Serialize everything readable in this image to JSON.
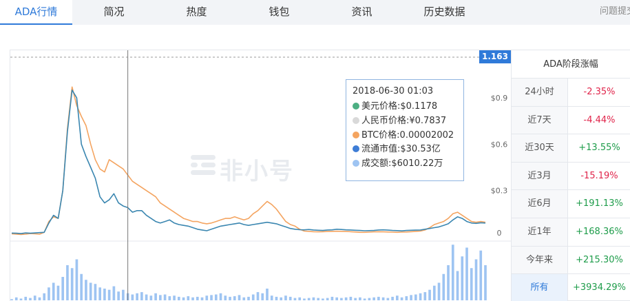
{
  "tabs": [
    {
      "label": "ADA行情",
      "active": true
    },
    {
      "label": "简况"
    },
    {
      "label": "热度"
    },
    {
      "label": "钱包"
    },
    {
      "label": "资讯"
    },
    {
      "label": "历史数据"
    }
  ],
  "feedback_label": "问题提交",
  "chart": {
    "price_badge": "1.163",
    "watermark": "非小号",
    "tooltip": {
      "time": "2018-06-30 01:03",
      "rows": [
        {
          "text": "美元价格:$0.1178",
          "color": "#4caf83"
        },
        {
          "text": "人民币价格:¥0.7837",
          "color": "#d9d9d9"
        },
        {
          "text": "BTC价格:0.00002002",
          "color": "#f4a460"
        },
        {
          "text": "流通市值:$30.53亿",
          "color": "#3e7dd6"
        },
        {
          "text": "成交额:$6010.22万",
          "color": "#9ec4f2"
        }
      ]
    }
  },
  "chart_data": {
    "type": "line",
    "ylim": [
      0,
      1.163
    ],
    "yticks": [
      "$0.9",
      "$0.6",
      "$0.3",
      "0"
    ],
    "ytick_values": [
      0.9,
      0.6,
      0.3,
      0
    ],
    "reference_line": 1.163,
    "crosshair_index": 25,
    "x_count": 103,
    "series": [
      {
        "name": "美元价格",
        "color": "#3a86b0",
        "values": [
          0.025,
          0.024,
          0.022,
          0.026,
          0.024,
          0.026,
          0.028,
          0.03,
          0.09,
          0.14,
          0.12,
          0.3,
          0.68,
          0.95,
          0.9,
          0.6,
          0.52,
          0.45,
          0.38,
          0.26,
          0.22,
          0.24,
          0.28,
          0.22,
          0.2,
          0.19,
          0.16,
          0.17,
          0.17,
          0.14,
          0.12,
          0.1,
          0.09,
          0.1,
          0.11,
          0.09,
          0.08,
          0.075,
          0.07,
          0.06,
          0.05,
          0.045,
          0.04,
          0.05,
          0.06,
          0.07,
          0.075,
          0.08,
          0.085,
          0.09,
          0.08,
          0.075,
          0.08,
          0.085,
          0.09,
          0.095,
          0.09,
          0.085,
          0.075,
          0.065,
          0.055,
          0.05,
          0.047,
          0.046,
          0.048,
          0.045,
          0.043,
          0.042,
          0.045,
          0.046,
          0.05,
          0.048,
          0.046,
          0.045,
          0.043,
          0.042,
          0.04,
          0.041,
          0.042,
          0.045,
          0.046,
          0.044,
          0.042,
          0.041,
          0.039,
          0.042,
          0.043,
          0.044,
          0.045,
          0.05,
          0.055,
          0.06,
          0.065,
          0.075,
          0.085,
          0.11,
          0.13,
          0.12,
          0.1,
          0.09,
          0.088,
          0.092,
          0.09
        ]
      },
      {
        "name": "BTC价格",
        "color": "#f4a460",
        "values": [
          0.02,
          0.018,
          0.016,
          0.018,
          0.022,
          0.02,
          0.018,
          0.03,
          0.1,
          0.13,
          0.12,
          0.3,
          0.7,
          0.97,
          0.85,
          0.78,
          0.72,
          0.6,
          0.5,
          0.44,
          0.42,
          0.5,
          0.48,
          0.46,
          0.44,
          0.4,
          0.36,
          0.34,
          0.32,
          0.3,
          0.28,
          0.26,
          0.22,
          0.2,
          0.18,
          0.16,
          0.14,
          0.12,
          0.11,
          0.1,
          0.1,
          0.09,
          0.085,
          0.09,
          0.1,
          0.11,
          0.12,
          0.12,
          0.13,
          0.12,
          0.11,
          0.12,
          0.15,
          0.17,
          0.2,
          0.23,
          0.21,
          0.18,
          0.14,
          0.1,
          0.08,
          0.07,
          0.05,
          0.038,
          0.036,
          0.034,
          0.033,
          0.034,
          0.035,
          0.036,
          0.037,
          0.036,
          0.035,
          0.034,
          0.032,
          0.03,
          0.03,
          0.031,
          0.033,
          0.034,
          0.033,
          0.032,
          0.031,
          0.03,
          0.031,
          0.032,
          0.034,
          0.036,
          0.038,
          0.045,
          0.06,
          0.08,
          0.09,
          0.1,
          0.12,
          0.15,
          0.16,
          0.14,
          0.12,
          0.1,
          0.095,
          0.1,
          0.095
        ]
      },
      {
        "name": "成交额",
        "color": "#9ec4f2",
        "values": [
          0.02,
          0.05,
          0.03,
          0.06,
          0.04,
          0.08,
          0.05,
          0.12,
          0.22,
          0.3,
          0.25,
          0.4,
          0.6,
          0.55,
          0.7,
          0.45,
          0.35,
          0.3,
          0.28,
          0.22,
          0.2,
          0.18,
          0.24,
          0.15,
          0.18,
          0.12,
          0.1,
          0.12,
          0.14,
          0.1,
          0.08,
          0.12,
          0.09,
          0.1,
          0.07,
          0.08,
          0.06,
          0.05,
          0.07,
          0.05,
          0.06,
          0.05,
          0.08,
          0.09,
          0.1,
          0.12,
          0.08,
          0.06,
          0.07,
          0.09,
          0.05,
          0.06,
          0.1,
          0.14,
          0.12,
          0.2,
          0.08,
          0.06,
          0.05,
          0.08,
          0.06,
          0.04,
          0.05,
          0.03,
          0.04,
          0.05,
          0.04,
          0.03,
          0.04,
          0.06,
          0.05,
          0.04,
          0.05,
          0.06,
          0.04,
          0.05,
          0.03,
          0.04,
          0.05,
          0.06,
          0.05,
          0.04,
          0.06,
          0.08,
          0.05,
          0.07,
          0.09,
          0.1,
          0.12,
          0.14,
          0.18,
          0.25,
          0.3,
          0.45,
          0.6,
          0.95,
          0.5,
          0.75,
          0.9,
          0.55,
          0.7,
          0.85,
          0.6
        ]
      }
    ]
  },
  "side": {
    "title": "ADA阶段涨幅",
    "rows": [
      {
        "label": "24小时",
        "value": "-2.35%",
        "dir": "neg"
      },
      {
        "label": "近7天",
        "value": "-4.44%",
        "dir": "neg"
      },
      {
        "label": "近30天",
        "value": "+13.55%",
        "dir": "pos"
      },
      {
        "label": "近3月",
        "value": "-15.19%",
        "dir": "neg"
      },
      {
        "label": "近6月",
        "value": "+191.13%",
        "dir": "pos"
      },
      {
        "label": "近1年",
        "value": "+168.36%",
        "dir": "pos"
      },
      {
        "label": "今年来",
        "value": "+215.30%",
        "dir": "pos"
      },
      {
        "label": "所有",
        "value": "+3934.29%",
        "dir": "pos",
        "selected": true
      }
    ]
  }
}
